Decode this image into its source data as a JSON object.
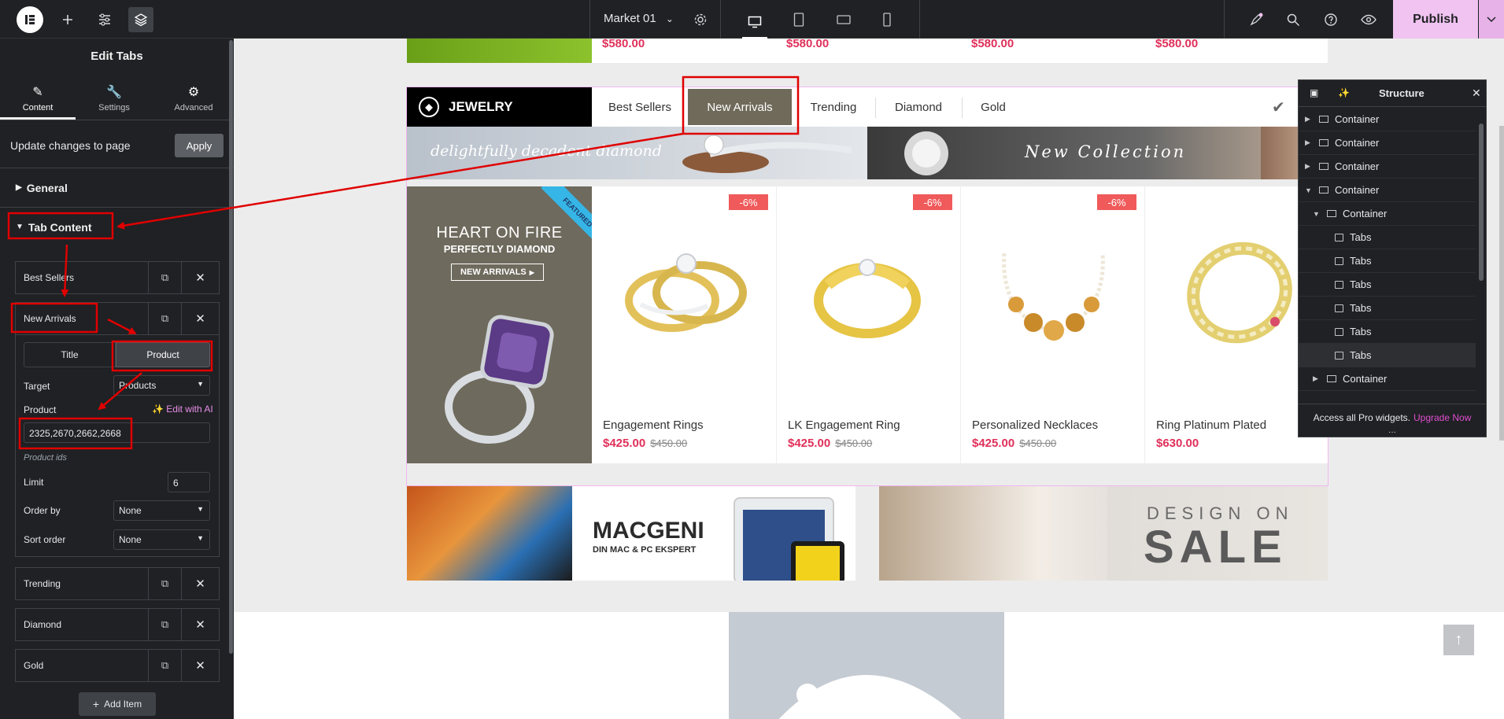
{
  "topbar": {
    "page_name": "Market 01",
    "publish_label": "Publish"
  },
  "panel": {
    "title": "Edit Tabs",
    "tabs": [
      {
        "label": "Content",
        "icon": "pencil-icon"
      },
      {
        "label": "Settings",
        "icon": "wrench-icon"
      },
      {
        "label": "Advanced",
        "icon": "gear-icon"
      }
    ],
    "update_text": "Update changes to page",
    "apply_label": "Apply",
    "section_general": "General",
    "section_tab_content": "Tab Content",
    "items": [
      "Best Sellers",
      "New Arrivals",
      "Trending",
      "Diamond",
      "Gold"
    ],
    "segment_title": "Title",
    "segment_product": "Product",
    "target_label": "Target",
    "target_value": "Products",
    "product_label": "Product",
    "edit_ai_label": "Edit with AI",
    "product_ids_value": "2325,2670,2662,2668",
    "product_ids_help": "Product ids",
    "limit_label": "Limit",
    "limit_value": "6",
    "order_by_label": "Order by",
    "order_by_value": "None",
    "sort_order_label": "Sort order",
    "sort_order_value": "None",
    "add_item_label": "Add Item"
  },
  "canvas": {
    "top_prices": [
      "$580.00",
      "$580.00",
      "$580.00",
      "$580.00"
    ],
    "widget_title": "JEWELRY",
    "widget_tabs": [
      "Best Sellers",
      "New Arrivals",
      "Trending",
      "Diamond",
      "Gold"
    ],
    "banner_left_text": "delightfully decadent diamond",
    "banner_right_text": "New Collection",
    "promo": {
      "ribbon": "FEATURED",
      "line1": "HEART ON FIRE",
      "line2": "PERFECTLY DIAMOND",
      "button": "NEW ARRIVALS"
    },
    "products": [
      {
        "name": "Engagement Rings",
        "price": "$425.00",
        "old_price": "$450.00",
        "discount": "-6%"
      },
      {
        "name": "LK Engagement Ring",
        "price": "$425.00",
        "old_price": "$450.00",
        "discount": "-6%"
      },
      {
        "name": "Personalized Necklaces",
        "price": "$425.00",
        "old_price": "$450.00",
        "discount": "-6%"
      },
      {
        "name": "Ring Platinum Plated",
        "price": "$630.00",
        "old_price": "",
        "discount": ""
      }
    ],
    "mac_banner": {
      "brand": "MACGENI",
      "tagline": "DIN MAC & PC EKSPERT"
    },
    "sale_banner": {
      "line1": "DESIGN ON",
      "line2": "SALE"
    }
  },
  "structure": {
    "title": "Structure",
    "rows": [
      {
        "label": "Container",
        "type": "container",
        "arrow": "right"
      },
      {
        "label": "Container",
        "type": "container",
        "arrow": "right"
      },
      {
        "label": "Container",
        "type": "container",
        "arrow": "right"
      },
      {
        "label": "Container",
        "type": "container",
        "arrow": "down"
      },
      {
        "label": "Container",
        "type": "container",
        "arrow": "down"
      },
      {
        "label": "Tabs",
        "type": "tabs",
        "arrow": ""
      },
      {
        "label": "Tabs",
        "type": "tabs",
        "arrow": ""
      },
      {
        "label": "Tabs",
        "type": "tabs",
        "arrow": ""
      },
      {
        "label": "Tabs",
        "type": "tabs",
        "arrow": ""
      },
      {
        "label": "Tabs",
        "type": "tabs",
        "arrow": ""
      },
      {
        "label": "Tabs",
        "type": "tabs",
        "arrow": ""
      },
      {
        "label": "Container",
        "type": "container",
        "arrow": "right"
      }
    ],
    "promo_text": "Access all Pro widgets.",
    "promo_link": "Upgrade Now"
  },
  "colors": {
    "accent_pink": "#e0305a",
    "publish_bg": "#f0c3f0",
    "annotation_red": "#e00000",
    "editor_dark": "#1f2124"
  }
}
